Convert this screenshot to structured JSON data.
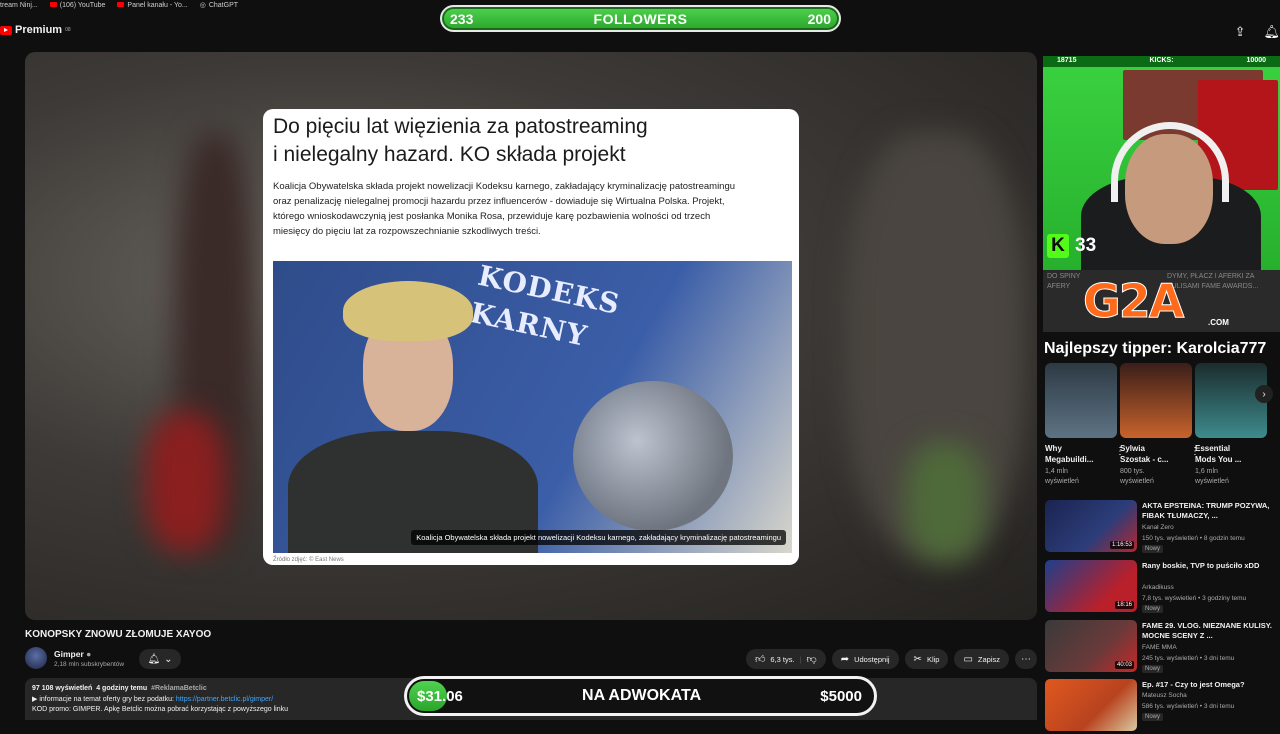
{
  "bookmarks": [
    {
      "label": "tream Ninj..."
    },
    {
      "label": "(106) YouTube"
    },
    {
      "label": "Panel kanału - Yo..."
    },
    {
      "label": "ChatGPT"
    }
  ],
  "masthead": {
    "logo_text": "Premium",
    "logo_region": "08",
    "icons": [
      "search-icon",
      "upload-icon",
      "notifications-icon"
    ]
  },
  "followers_goal": {
    "current": "233",
    "title": "FOLLOWERS",
    "target": "200",
    "progress": 1.0
  },
  "article": {
    "headline_line1": "Do pięciu lat więzienia za patostreaming",
    "headline_line2": "i nielegalny hazard. KO składa projekt",
    "body": "Koalicja Obywatelska składa projekt nowelizacji Kodeksu karnego, zakładający kryminalizację patostreamingu oraz penalizację nielegalnej promocji hazardu przez influencerów - dowiaduje się Wirtualna Polska. Projekt, którego wnioskodawczynią jest posłanka Monika Rosa, przewiduje karę pozbawienia wolności od trzech miesięcy do pięciu lat za rozpowszechnianie szkodliwych treści.",
    "photo_book_line1": "KODEKS",
    "photo_book_line2": "KARNY",
    "photo_caption": "Koalicja Obywatelska składa projekt nowelizacji Kodeksu karnego, zakładający kryminalizację patostreamingu",
    "photo_credit": "Źródło zdjęć: © East News"
  },
  "video": {
    "title": "KONOPSKY ZNOWU ZŁOMUJE XAYOO",
    "channel_name": "Gimper",
    "subscribers": "2,18 mln subskrybentów",
    "likes": "6,3 tys.",
    "share_label": "Udostępnij",
    "clip_label": "Klip",
    "save_label": "Zapisz"
  },
  "description": {
    "views": "97 108 wyświetleń",
    "time": "4 godziny temu",
    "hashtag": "#ReklamaBetclic",
    "line2_prefix": "▶ informacje na temat oferty gry bez podatku:",
    "line2_link": "https://partner.betclic.pl/gimper/",
    "line3": "KOD promo: GIMPER. Apkę Betclic można pobrać korzystając z powyższego linku"
  },
  "donation_goal": {
    "current": "$31.06",
    "title": "NA ADWOKATA",
    "target": "$5000",
    "progress": 0.0062
  },
  "cam_overlay": {
    "left_count": "18715",
    "label": "KICKS:",
    "right_count": "10000",
    "kick_viewers": "33",
    "kick_logo": "K"
  },
  "sponsor": {
    "logo": "G2A",
    "logo_suffix": ".COM",
    "bg_line1": "DO SPINY",
    "bg_line2": "AFERY",
    "bg_line3": "DYMY, PŁACZ I AFERKI ZA",
    "bg_line4": "KULISAMI FAME AWARDS..."
  },
  "top_tipper": "Najlepszy tipper: Karolcia777",
  "shorts": [
    {
      "title_line1": "Why",
      "title_line2": "Megabuildi...",
      "views_line1": "1,4 mln",
      "views_line2": "wyświetleń",
      "color": "#5d7384"
    },
    {
      "title_line1": "Sylwia",
      "title_line2": "Szostak - c...",
      "views_line1": "800 tys.",
      "views_line2": "wyświetleń",
      "color": "#c8632b"
    },
    {
      "title_line1": "Essential",
      "title_line2": "Mods You ...",
      "views_line1": "1,6 mln",
      "views_line2": "wyświetleń",
      "color": "#3e8b8c"
    }
  ],
  "recommendations": [
    {
      "title": "AKTA EPSTEINA: TRUMP POZYWA, FIBAK TŁUMACZY, ...",
      "channel": "Kanał Zero",
      "meta": "150 tys. wyświetleń • 8 godzin temu",
      "badge": "Nowy",
      "duration": "1:16:53",
      "color": "#2c3d7a"
    },
    {
      "title": "Rany boskie, TVP to puściło xDD",
      "channel": "Arkadikuss",
      "meta": "7,8 tys. wyświetleń • 3 godziny temu",
      "badge": "Nowy",
      "duration": "18:16",
      "color": "#1e3f8c"
    },
    {
      "title": "FAME 29. VLOG. NIEZNANE KULISY. MOCNE SCENY Z ...",
      "channel": "FAME MMA",
      "meta": "245 tys. wyświetleń • 3 dni temu",
      "badge": "Nowy",
      "duration": "40:03",
      "color": "#6a3a3a"
    },
    {
      "title": "Ep. #17 - Czy to jest Omega?",
      "channel": "Mateusz Socha",
      "meta": "586 tys. wyświetleń • 3 dni temu",
      "badge": "Nowy",
      "duration": "",
      "color": "#b8431f"
    }
  ]
}
